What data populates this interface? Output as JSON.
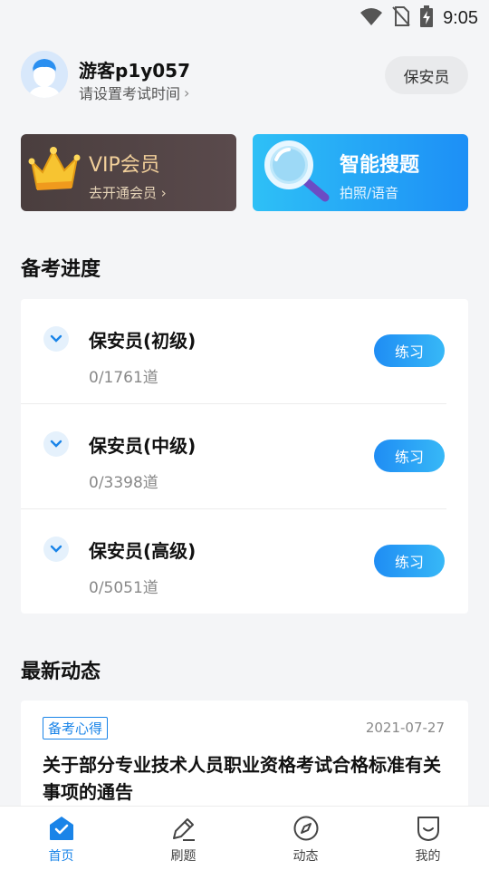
{
  "status_bar": {
    "time": "9:05"
  },
  "profile": {
    "username": "游客p1y057",
    "subtitle": "请设置考试时间",
    "subtitle_chevron": "›",
    "exam_tag": "保安员"
  },
  "vip_card": {
    "title": "VIP会员",
    "subtitle": "去开通会员 ›"
  },
  "search_card": {
    "title": "智能搜题",
    "subtitle": "拍照/语音"
  },
  "progress_section": {
    "title": "备考进度",
    "items": [
      {
        "name": "保安员(初级)",
        "count": "0/1761道",
        "button": "练习"
      },
      {
        "name": "保安员(中级)",
        "count": "0/3398道",
        "button": "练习"
      },
      {
        "name": "保安员(高级)",
        "count": "0/5051道",
        "button": "练习"
      }
    ]
  },
  "news_section": {
    "title": "最新动态",
    "items": [
      {
        "tag": "备考心得",
        "date": "2021-07-27",
        "title": "关于部分专业技术人员职业资格考试合格标准有关事项的通告"
      }
    ]
  },
  "bottom_nav": [
    {
      "label": "首页",
      "icon": "home-icon",
      "active": true
    },
    {
      "label": "刷题",
      "icon": "pencil-icon",
      "active": false
    },
    {
      "label": "动态",
      "icon": "compass-icon",
      "active": false
    },
    {
      "label": "我的",
      "icon": "profile-icon",
      "active": false
    }
  ],
  "colors": {
    "accent": "#1a84e8",
    "vip_gold": "#f1cf9a",
    "practice_blue": "#1f8df4"
  }
}
